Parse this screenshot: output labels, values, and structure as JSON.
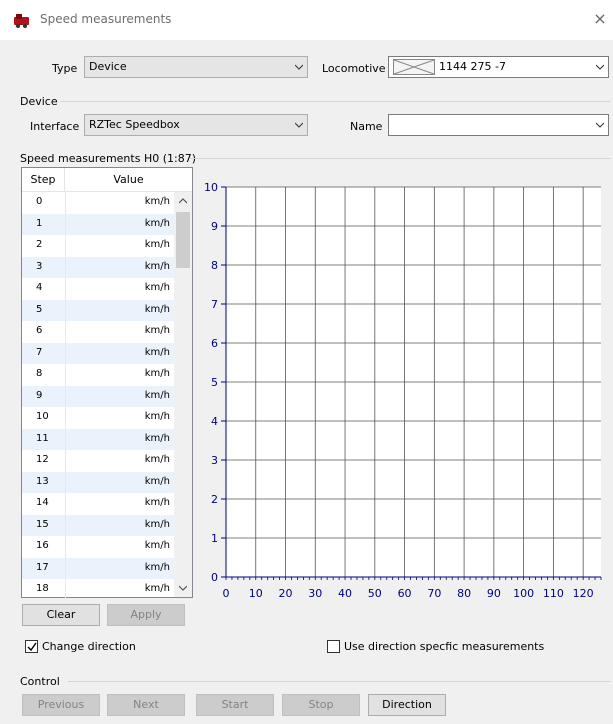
{
  "window": {
    "title": "Speed measurements",
    "close_glyph": "×"
  },
  "top": {
    "type_label": "Type",
    "type_value": "Device",
    "locomotive_label": "Locomotive",
    "locomotive_value": "1144 275 -7"
  },
  "device": {
    "group_label": "Device",
    "interface_label": "Interface",
    "interface_value": "RZTec Speedbox",
    "name_label": "Name",
    "name_value": ""
  },
  "measurements": {
    "group_label": "Speed measurements H0 (1:87)",
    "columns": [
      "Step",
      "Value"
    ],
    "unit": "km/h",
    "rows": [
      "0",
      "1",
      "2",
      "3",
      "4",
      "5",
      "6",
      "7",
      "8",
      "9",
      "10",
      "11",
      "12",
      "13",
      "14",
      "15",
      "16",
      "17",
      "18"
    ],
    "clear_label": "Clear",
    "apply_label": "Apply"
  },
  "options": {
    "change_direction_label": "Change direction",
    "change_direction_checked": true,
    "direction_specific_label": "Use direction specfic measurements",
    "direction_specific_checked": false
  },
  "control": {
    "group_label": "Control",
    "previous_label": "Previous",
    "next_label": "Next",
    "start_label": "Start",
    "stop_label": "Stop",
    "direction_label": "Direction"
  },
  "chart_data": {
    "type": "line",
    "title": "",
    "xlabel": "",
    "ylabel": "",
    "xlim": [
      0,
      126
    ],
    "ylim": [
      0,
      10
    ],
    "xticks": [
      0,
      10,
      20,
      30,
      40,
      50,
      60,
      70,
      80,
      90,
      100,
      110,
      120
    ],
    "yticks": [
      0,
      1,
      2,
      3,
      4,
      5,
      6,
      7,
      8,
      9,
      10
    ],
    "grid": true,
    "series": [],
    "axis_color": "#000080",
    "grid_color": "#000000"
  }
}
